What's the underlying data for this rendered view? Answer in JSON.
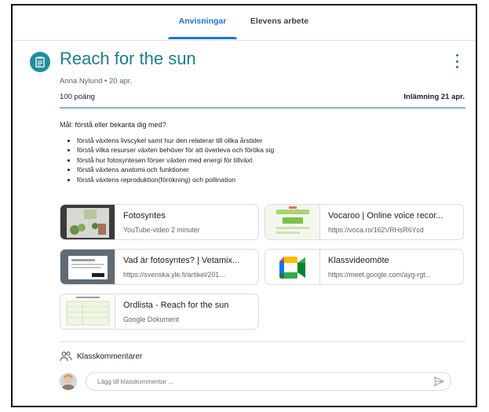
{
  "tabs": {
    "active": "Anvisningar",
    "other": "Elevens arbete"
  },
  "assignment": {
    "title": "Reach for the sun",
    "meta": "Anna Nylund • 20 apr.",
    "points": "100 poäng",
    "due": "Inlämning 21 apr.",
    "goal": "Mål: förstå eller bekanta dig med?",
    "bullets": [
      "förstå växtens livscykel samt hur den relaterar till olika årstider",
      "förstå vilka resurser växten behöver för att överleva och föröka sig",
      "förstå hur fotosyntesen förser växten med energi för tillväxt",
      "förstå växtens anatomi och funktioner",
      "förstå växtens reproduktion(förökning) och pollination"
    ]
  },
  "attachments": [
    {
      "title": "Fotosyntes",
      "subtitle": "YouTube-video   2 minuter"
    },
    {
      "title": "Vocaroo | Online voice recor...",
      "subtitle": "https://voca.ro/162VRHsR6Ycd"
    },
    {
      "title": "Vad är fotosyntes? | Vetamix...",
      "subtitle": "https://svenska.yle.fi/artikel/201..."
    },
    {
      "title": "Klassvideomöte",
      "subtitle": "https://meet.google.com/ayg-rgt..."
    },
    {
      "title": "Ordlista - Reach for the sun",
      "subtitle": "Google Dokument"
    }
  ],
  "comments": {
    "heading": "Klasskommentarer",
    "placeholder": "Lägg till klasskommentar ..."
  },
  "colors": {
    "accent": "#1a73e8",
    "teal": "#1a7f8e"
  }
}
